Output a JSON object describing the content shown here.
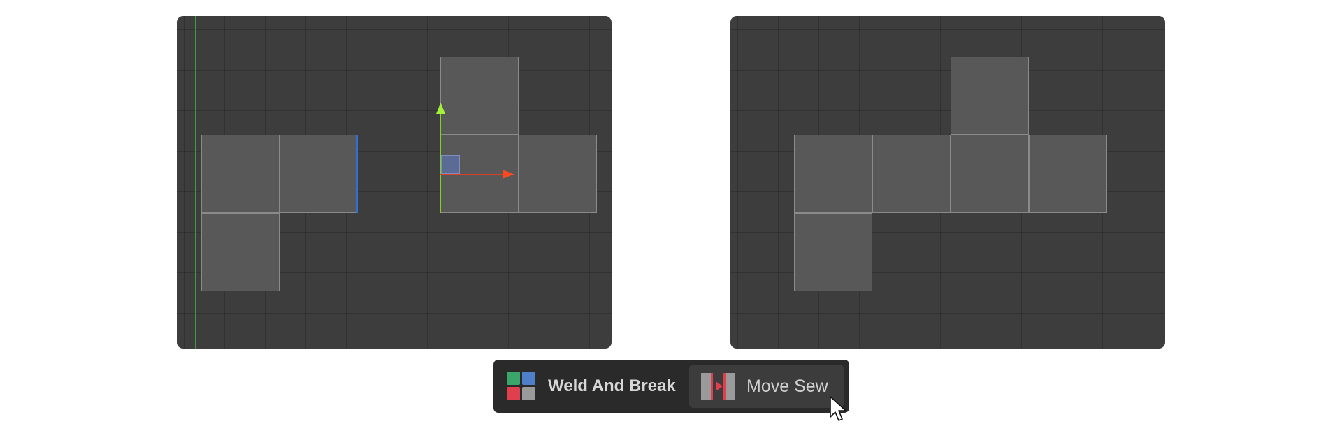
{
  "viewports": {
    "left": {
      "description_name": "uv-editor-before",
      "faces": 6,
      "selected_edge": "seam"
    },
    "right": {
      "description_name": "uv-editor-after",
      "faces": 6
    }
  },
  "toolbar": {
    "title": "Weld And Break",
    "button_label": "Move Sew"
  },
  "colors": {
    "viewport_bg": "#3d3d3d",
    "face": "#585858",
    "face_edge": "#8a8a8a",
    "axis_y": "#3f9a38",
    "axis_x": "#a8302c",
    "seam": "#2f6fd6",
    "gizmo_y": "#7ed321",
    "gizmo_x": "#d8402a",
    "icon_green": "#3aa66a",
    "icon_blue": "#4f7fc8",
    "icon_red": "#e0404e",
    "icon_gray": "#9a9a9a"
  },
  "icons": [
    "weld-and-break-icon",
    "move-sew-icon",
    "mouse-pointer-icon"
  ]
}
